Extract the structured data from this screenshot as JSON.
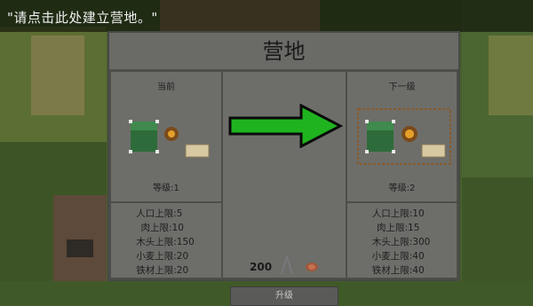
{
  "tooltip": {
    "text": "\"请点击此处建立营地。\""
  },
  "panel": {
    "title": "营地",
    "current": {
      "header": "当前",
      "level": "等级:1",
      "stats": [
        {
          "label": "人口上限:",
          "value": "5"
        },
        {
          "label": "肉上限:",
          "value": "10"
        },
        {
          "label": "木头上限:",
          "value": "150"
        },
        {
          "label": "小麦上限:",
          "value": "20"
        },
        {
          "label": "铁材上限:",
          "value": "20"
        }
      ]
    },
    "next": {
      "header": "下一级",
      "level": "等级:2",
      "stats": [
        {
          "label": "人口上限:",
          "value": "10"
        },
        {
          "label": "肉上限:",
          "value": "15"
        },
        {
          "label": "木头上限:",
          "value": "300"
        },
        {
          "label": "小麦上限:",
          "value": "40"
        },
        {
          "label": "铁材上限:",
          "value": "40"
        }
      ]
    },
    "upgrade": {
      "cost": "200",
      "cost_icon": "meat-icon",
      "button_label": "升级"
    }
  },
  "colors": {
    "arrow_fill": "#1fb31f",
    "panel_bg": "#6a6b67",
    "tent_green": "#2e6b3a"
  }
}
